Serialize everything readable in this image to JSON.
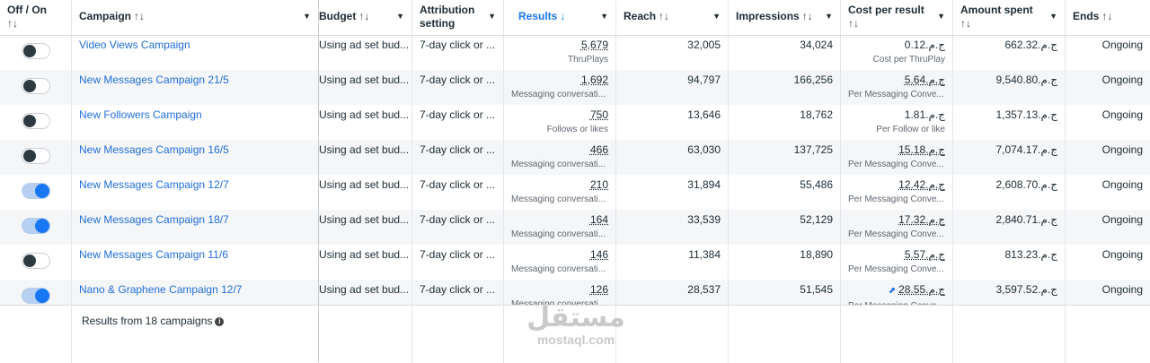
{
  "columns": {
    "toggle": {
      "label": "Off / On",
      "sort": "↑↓"
    },
    "campaign": {
      "label": "Campaign",
      "sort": "↑↓"
    },
    "budget": {
      "label": "Budget",
      "sort": "↑↓"
    },
    "attribution": {
      "label": "Attribution setting"
    },
    "results": {
      "label": "Results",
      "sort": "↓"
    },
    "reach": {
      "label": "Reach",
      "sort": "↑↓"
    },
    "impressions": {
      "label": "Impressions",
      "sort": "↑↓"
    },
    "cost": {
      "label": "Cost per result",
      "sort": "↑↓"
    },
    "amount": {
      "label": "Amount spent",
      "sort": "↑↓"
    },
    "ends": {
      "label": "Ends",
      "sort": "↑↓"
    }
  },
  "rows": [
    {
      "on": false,
      "name": "Video Views Campaign",
      "budget": "Using ad set bud...",
      "attribution": "7-day click or ...",
      "results": "5,679",
      "results_sub": "ThruPlays",
      "reach": "32,005",
      "impressions": "34,024",
      "cost": "ج.م.0.12",
      "cost_sub": "Cost per ThruPlay",
      "amount": "ج.م.662.32",
      "ends": "Ongoing"
    },
    {
      "on": false,
      "name": "New Messages Campaign 21/5",
      "budget": "Using ad set bud...",
      "attribution": "7-day click or ...",
      "results": "1,692",
      "results_sub": "Messaging conversati...",
      "reach": "94,797",
      "impressions": "166,256",
      "cost": "ج.م.5.64",
      "cost_sub": "Per Messaging Conve...",
      "amount": "ج.م.9,540.80",
      "ends": "Ongoing"
    },
    {
      "on": false,
      "name": "New Followers Campaign",
      "budget": "Using ad set bud...",
      "attribution": "7-day click or ...",
      "results": "750",
      "results_sub": "Follows or likes",
      "reach": "13,646",
      "impressions": "18,762",
      "cost": "ج.م.1.81",
      "cost_sub": "Per Follow or like",
      "amount": "ج.م.1,357.13",
      "ends": "Ongoing"
    },
    {
      "on": false,
      "name": "New Messages Campaign 16/5",
      "budget": "Using ad set bud...",
      "attribution": "7-day click or ...",
      "results": "466",
      "results_sub": "Messaging conversati...",
      "reach": "63,030",
      "impressions": "137,725",
      "cost": "ج.م.15.18",
      "cost_sub": "Per Messaging Conve...",
      "amount": "ج.م.7,074.17",
      "ends": "Ongoing"
    },
    {
      "on": true,
      "name": "New Messages Campaign 12/7",
      "budget": "Using ad set bud...",
      "attribution": "7-day click or ...",
      "results": "210",
      "results_sub": "Messaging conversati...",
      "reach": "31,894",
      "impressions": "55,486",
      "cost": "ج.م.12.42",
      "cost_sub": "Per Messaging Conve...",
      "amount": "ج.م.2,608.70",
      "ends": "Ongoing"
    },
    {
      "on": true,
      "name": "New Messages Campaign 18/7",
      "budget": "Using ad set bud...",
      "attribution": "7-day click or ...",
      "results": "164",
      "results_sub": "Messaging conversati...",
      "reach": "33,539",
      "impressions": "52,129",
      "cost": "ج.م.17.32",
      "cost_sub": "Per Messaging Conve...",
      "amount": "ج.م.2,840.71",
      "ends": "Ongoing"
    },
    {
      "on": false,
      "name": "New Messages Campaign 11/6",
      "budget": "Using ad set bud...",
      "attribution": "7-day click or ...",
      "results": "146",
      "results_sub": "Messaging conversati...",
      "reach": "11,384",
      "impressions": "18,890",
      "cost": "ج.م.5.57",
      "cost_sub": "Per Messaging Conve...",
      "amount": "ج.م.813.23",
      "ends": "Ongoing"
    },
    {
      "on": true,
      "name": "Nano & Graphene Campaign 12/7",
      "budget": "Using ad set bud...",
      "attribution": "7-day click or ...",
      "results": "126",
      "results_sub": "Messaging conversati...",
      "reach": "28,537",
      "impressions": "51,545",
      "cost": "ج.م.28.55",
      "cost_sub": "Per Messaging Conve...",
      "amount": "ج.م.3,597.52",
      "ends": "Ongoing",
      "cost_trend": true
    }
  ],
  "footer": {
    "summary": "Results from 18 campaigns",
    "info_icon": "info-icon"
  },
  "watermark": {
    "arabic": "مستقل",
    "latin": "mostaql.com"
  },
  "colors": {
    "link": "#216fdb",
    "toggle_on": "#1877f2",
    "active_sort": "#1877f2"
  }
}
